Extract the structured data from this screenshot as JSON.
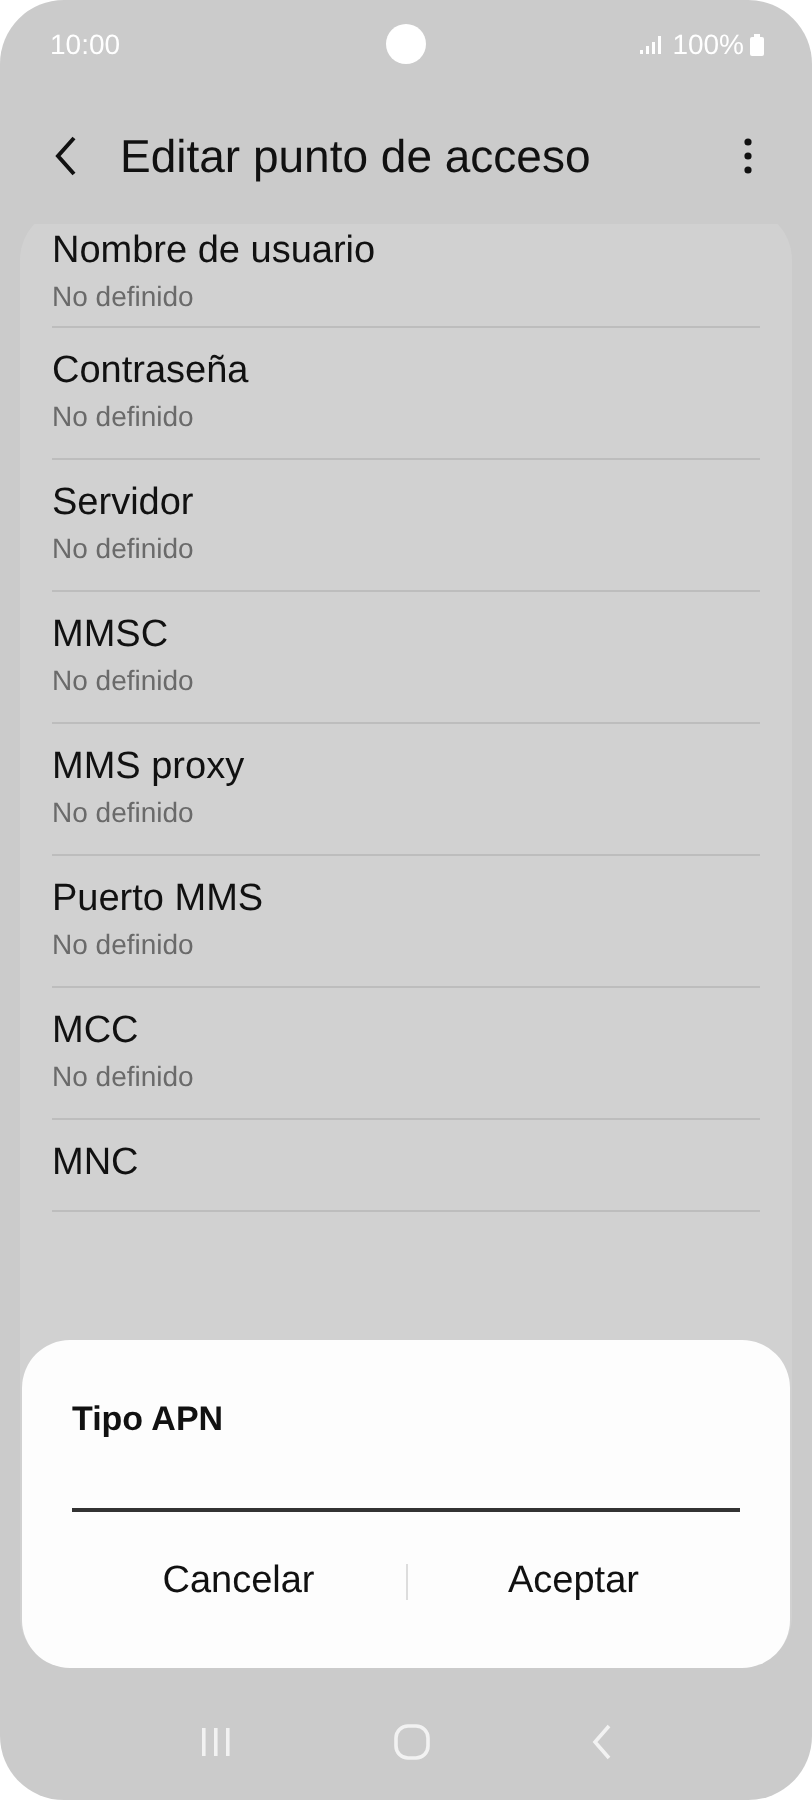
{
  "status_bar": {
    "time": "10:00",
    "battery": "100%"
  },
  "header": {
    "title": "Editar punto de acceso"
  },
  "items": [
    {
      "title": "Nombre de usuario",
      "value": "No definido"
    },
    {
      "title": "Contraseña",
      "value": "No definido"
    },
    {
      "title": "Servidor",
      "value": "No definido"
    },
    {
      "title": "MMSC",
      "value": "No definido"
    },
    {
      "title": "MMS proxy",
      "value": "No definido"
    },
    {
      "title": "Puerto MMS",
      "value": "No definido"
    },
    {
      "title": "MCC",
      "value": "No definido"
    },
    {
      "title": "MNC"
    }
  ],
  "dialog": {
    "title": "Tipo APN",
    "buttons": [
      "Cancelar",
      "Aceptar"
    ]
  }
}
